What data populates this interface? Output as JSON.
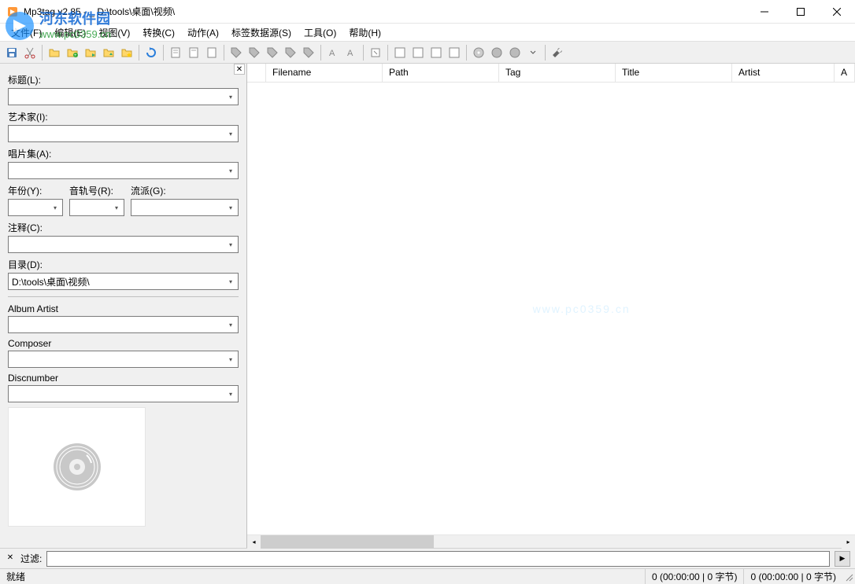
{
  "title": "Mp3tag v2.85 - _ D:\\tools\\桌面\\视频\\",
  "menu": {
    "file": "文件(F)",
    "edit": "编辑(E)",
    "view": "视图(V)",
    "convert": "转换(C)",
    "actions": "动作(A)",
    "sources": "标签数据源(S)",
    "tools": "工具(O)",
    "help": "帮助(H)"
  },
  "fields": {
    "title_label": "标题(L):",
    "artist_label": "艺术家(I):",
    "album_label": "唱片集(A):",
    "year_label": "年份(Y):",
    "track_label": "音轨号(R):",
    "genre_label": "流派(G):",
    "comment_label": "注释(C):",
    "directory_label": "目录(D):",
    "directory_value": "D:\\tools\\桌面\\视频\\",
    "album_artist_label": "Album Artist",
    "composer_label": "Composer",
    "discnumber_label": "Discnumber"
  },
  "columns": {
    "filename": "Filename",
    "path": "Path",
    "tag": "Tag",
    "title": "Title",
    "artist": "Artist",
    "a": "A"
  },
  "filter": {
    "label": "过滤:",
    "arrow": "▶"
  },
  "status": {
    "ready": "就绪",
    "info1": "0 (00:00:00 | 0 字节)",
    "info2": "0 (00:00:00 | 0 字节)"
  },
  "watermark": {
    "site_cn": "河东软件园",
    "site_url": "www.pc0359.cn",
    "center": "www.pc0359.cn"
  }
}
